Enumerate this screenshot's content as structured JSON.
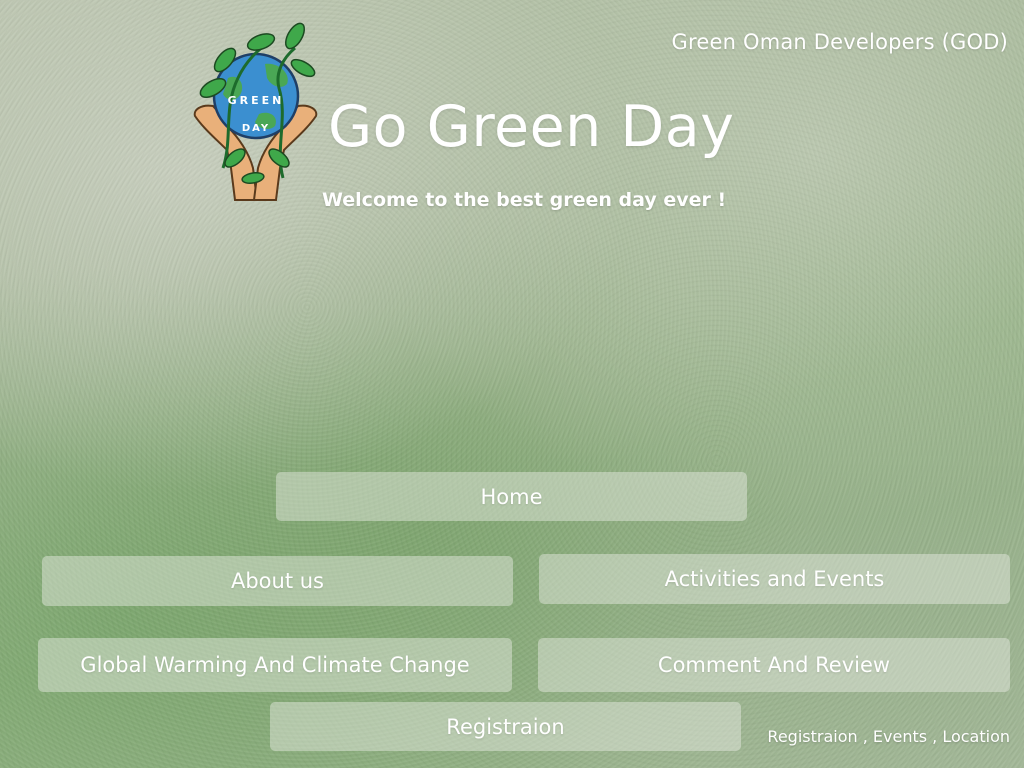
{
  "header": {
    "org_name": "Green Oman Developers (GOD)",
    "title": "Go Green Day",
    "tagline": "Welcome to the best green day ever !"
  },
  "logo": {
    "text_line1": "GREEN",
    "text_line2": "DAY",
    "icon": "globe-in-hands-logo"
  },
  "nav": {
    "home": "Home",
    "about": "About us",
    "activities": "Activities and Events",
    "global_warming": "Global Warming And Climate Change",
    "comment": "Comment And Review",
    "registration": "Registraion"
  },
  "footer": {
    "links": "Registraion , Events , Location"
  },
  "colors": {
    "background_green": "#9fb890",
    "button_fill": "#eceee6",
    "text": "#ffffff",
    "leaf_green": "#3fa84a",
    "globe_blue": "#3b8fd0",
    "hand_skin": "#e9b07a"
  }
}
